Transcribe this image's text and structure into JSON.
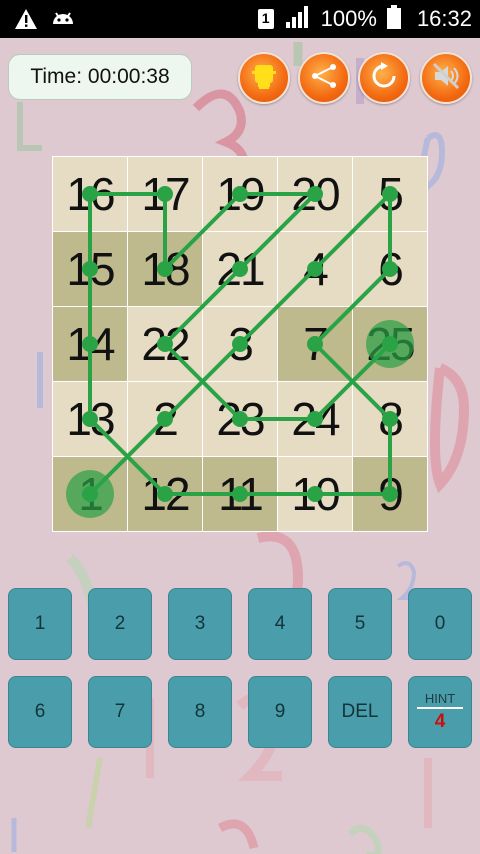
{
  "status_bar": {
    "battery_percent": "100%",
    "time": "16:32",
    "sim_label": "1",
    "icons": [
      "warning-icon",
      "android-icon",
      "sim-icon",
      "signal-icon",
      "battery-icon"
    ]
  },
  "timer": {
    "text": "Time: 00:00:38"
  },
  "toolbar": {
    "buttons": [
      "lightbulb-hint",
      "share",
      "restart",
      "sound-muted"
    ]
  },
  "board": {
    "rows": [
      [
        "16",
        "17",
        "19",
        "20",
        "5"
      ],
      [
        "15",
        "18",
        "21",
        "4",
        "6"
      ],
      [
        "14",
        "22",
        "3",
        "7",
        "25"
      ],
      [
        "13",
        "2",
        "23",
        "24",
        "8"
      ],
      [
        "1",
        "12",
        "11",
        "10",
        "9"
      ]
    ],
    "shades": [
      [
        "light",
        "light",
        "light",
        "light",
        "light"
      ],
      [
        "dark",
        "dark",
        "light",
        "light",
        "light"
      ],
      [
        "dark",
        "light",
        "light",
        "dark",
        "dark"
      ],
      [
        "light",
        "light",
        "light",
        "light",
        "light"
      ],
      [
        "dark",
        "dark",
        "dark",
        "light",
        "dark"
      ]
    ],
    "path_color": "#2aa347",
    "start_value": "1",
    "end_value": "25"
  },
  "keypad": {
    "row1": [
      "1",
      "2",
      "3",
      "4",
      "5",
      "0"
    ],
    "row2": [
      "6",
      "7",
      "8",
      "9",
      "DEL"
    ],
    "hint_label": "HINT",
    "hint_count": "4"
  }
}
